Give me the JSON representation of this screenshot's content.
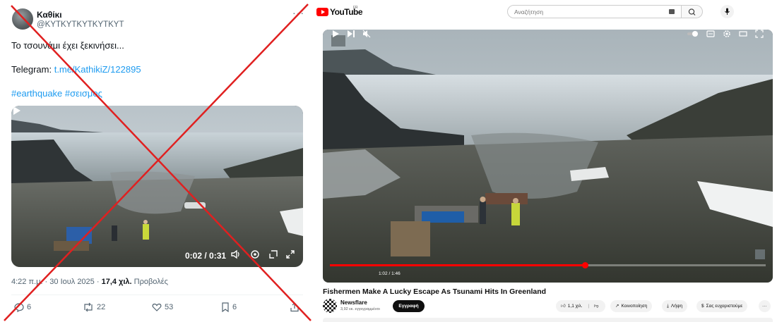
{
  "tweet": {
    "display_name": "Καθίκι",
    "handle": "@KYTKYTKYTKYTKYT",
    "more_icon": "more-dots-icon",
    "text_line1": "Το τσουνάμι έχει ξεκινήσει...",
    "telegram_label": "Telegram: ",
    "telegram_link": "t.me/KathikiZ/122895",
    "hashtag1": "#earthquake",
    "hashtag2": "#σεισμος",
    "video": {
      "time": "0:02 / 0:31"
    },
    "timestamp": "4:22 π.μ. · 30 Ιουλ 2025 · ",
    "views_count": "17,4 χιλ.",
    "views_label": " Προβολές",
    "actions": {
      "replies": "6",
      "retweets": "22",
      "likes": "53",
      "bookmarks": "6"
    },
    "overlay_color": "#e02020"
  },
  "youtube": {
    "logo_text": "YouTube",
    "country_code": "FR",
    "search_placeholder": "Αναζήτηση",
    "player": {
      "time": "1:02 / 1:46",
      "progress": 0.5849
    },
    "title": "Fishermen Make A Lucky Escape As Tsunami Hits In Greenland",
    "channel_name": "Newsflare",
    "channel_subs": "3,92 εκ. εγγεγραμμένοι",
    "subscribe_label": "Εγγραφή",
    "likes": "1,1 χιλ.",
    "share_label": "Κοινοποίηση",
    "download_label": "Λήψη",
    "thanks_label": "Σας ευχαριστούμε",
    "more_label": "···",
    "accent_color": "#ff0000"
  }
}
